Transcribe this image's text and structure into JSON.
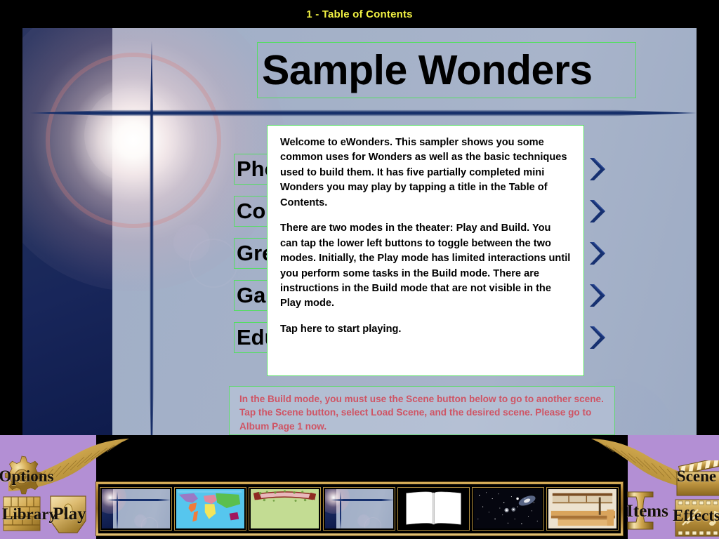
{
  "topbar": {
    "title": "1 - Table of Contents"
  },
  "stage": {
    "heading": "Sample Wonders",
    "toc": [
      {
        "label": "Photo Album",
        "arrow_icon": "chevron-right-icon"
      },
      {
        "label": "Contents",
        "arrow_icon": "chevron-right-icon"
      },
      {
        "label": "Greeting",
        "arrow_icon": "chevron-right-icon"
      },
      {
        "label": "Games",
        "arrow_icon": "chevron-right-icon"
      },
      {
        "label": "Education",
        "arrow_icon": "chevron-right-icon"
      }
    ]
  },
  "dialog": {
    "paragraph1": "Welcome to eWonders.  This sampler shows you some common uses for Wonders as well as the basic techniques used to build them.  It has five partially completed mini Wonders you may play by tapping a title in the Table of Contents.",
    "paragraph2": "There are two modes in the theater: Play and Build.  You can tap the lower left buttons to toggle between the two modes.  Initially, the Play mode has limited interactions until you perform some tasks in the Build mode.  There are instructions in the Build mode that are not visible in the Play mode.",
    "paragraph3": "Tap here to start playing."
  },
  "note": {
    "text": "In the Build mode, you must use the Scene button below to go to another scene.  Tap the Scene button, select Load Scene, and the desired scene.  Please go to Album Page 1 now.",
    "color": "#cf5464"
  },
  "toolbar": {
    "options_label": "Options",
    "options_icon": "gear-icon",
    "library_label": "Library",
    "library_icon": "books-icon",
    "play_label": "Play",
    "play_icon": "play-shield-icon",
    "items_label": "Items",
    "items_icon": "vase-icon",
    "scene_label": "Scene",
    "scene_icon": "clapperboard-icon",
    "effects_label": "Effects",
    "effects_icon": "filmstrip-icon",
    "thumbnails": [
      {
        "name": "scene-thumb-current"
      },
      {
        "name": "scene-thumb-world-map"
      },
      {
        "name": "scene-thumb-green-banner"
      },
      {
        "name": "scene-thumb-current-2"
      },
      {
        "name": "scene-thumb-open-book"
      },
      {
        "name": "scene-thumb-galaxy"
      },
      {
        "name": "scene-thumb-wood-shelf"
      }
    ]
  },
  "colors": {
    "title_yellow": "#f2f243",
    "stage_bg": "#a4b1c8",
    "navy": "#16306e",
    "green_border": "#55dd63",
    "toolbar_purple": "#b38fd4",
    "gold": "#c9a14f"
  }
}
